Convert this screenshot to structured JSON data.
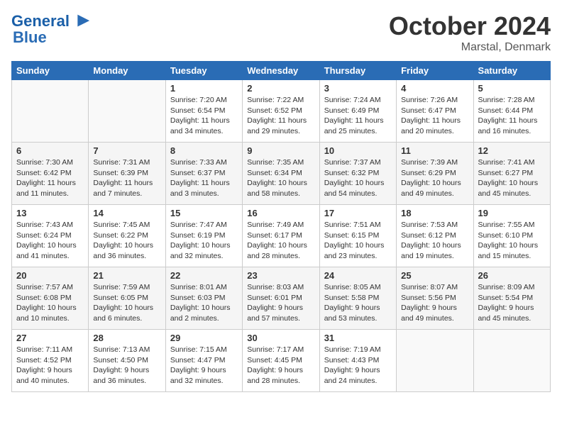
{
  "header": {
    "logo_line1": "General",
    "logo_line2": "Blue",
    "month": "October 2024",
    "location": "Marstal, Denmark"
  },
  "weekdays": [
    "Sunday",
    "Monday",
    "Tuesday",
    "Wednesday",
    "Thursday",
    "Friday",
    "Saturday"
  ],
  "weeks": [
    [
      {
        "day": "",
        "sunrise": "",
        "sunset": "",
        "daylight": ""
      },
      {
        "day": "",
        "sunrise": "",
        "sunset": "",
        "daylight": ""
      },
      {
        "day": "1",
        "sunrise": "Sunrise: 7:20 AM",
        "sunset": "Sunset: 6:54 PM",
        "daylight": "Daylight: 11 hours and 34 minutes."
      },
      {
        "day": "2",
        "sunrise": "Sunrise: 7:22 AM",
        "sunset": "Sunset: 6:52 PM",
        "daylight": "Daylight: 11 hours and 29 minutes."
      },
      {
        "day": "3",
        "sunrise": "Sunrise: 7:24 AM",
        "sunset": "Sunset: 6:49 PM",
        "daylight": "Daylight: 11 hours and 25 minutes."
      },
      {
        "day": "4",
        "sunrise": "Sunrise: 7:26 AM",
        "sunset": "Sunset: 6:47 PM",
        "daylight": "Daylight: 11 hours and 20 minutes."
      },
      {
        "day": "5",
        "sunrise": "Sunrise: 7:28 AM",
        "sunset": "Sunset: 6:44 PM",
        "daylight": "Daylight: 11 hours and 16 minutes."
      }
    ],
    [
      {
        "day": "6",
        "sunrise": "Sunrise: 7:30 AM",
        "sunset": "Sunset: 6:42 PM",
        "daylight": "Daylight: 11 hours and 11 minutes."
      },
      {
        "day": "7",
        "sunrise": "Sunrise: 7:31 AM",
        "sunset": "Sunset: 6:39 PM",
        "daylight": "Daylight: 11 hours and 7 minutes."
      },
      {
        "day": "8",
        "sunrise": "Sunrise: 7:33 AM",
        "sunset": "Sunset: 6:37 PM",
        "daylight": "Daylight: 11 hours and 3 minutes."
      },
      {
        "day": "9",
        "sunrise": "Sunrise: 7:35 AM",
        "sunset": "Sunset: 6:34 PM",
        "daylight": "Daylight: 10 hours and 58 minutes."
      },
      {
        "day": "10",
        "sunrise": "Sunrise: 7:37 AM",
        "sunset": "Sunset: 6:32 PM",
        "daylight": "Daylight: 10 hours and 54 minutes."
      },
      {
        "day": "11",
        "sunrise": "Sunrise: 7:39 AM",
        "sunset": "Sunset: 6:29 PM",
        "daylight": "Daylight: 10 hours and 49 minutes."
      },
      {
        "day": "12",
        "sunrise": "Sunrise: 7:41 AM",
        "sunset": "Sunset: 6:27 PM",
        "daylight": "Daylight: 10 hours and 45 minutes."
      }
    ],
    [
      {
        "day": "13",
        "sunrise": "Sunrise: 7:43 AM",
        "sunset": "Sunset: 6:24 PM",
        "daylight": "Daylight: 10 hours and 41 minutes."
      },
      {
        "day": "14",
        "sunrise": "Sunrise: 7:45 AM",
        "sunset": "Sunset: 6:22 PM",
        "daylight": "Daylight: 10 hours and 36 minutes."
      },
      {
        "day": "15",
        "sunrise": "Sunrise: 7:47 AM",
        "sunset": "Sunset: 6:19 PM",
        "daylight": "Daylight: 10 hours and 32 minutes."
      },
      {
        "day": "16",
        "sunrise": "Sunrise: 7:49 AM",
        "sunset": "Sunset: 6:17 PM",
        "daylight": "Daylight: 10 hours and 28 minutes."
      },
      {
        "day": "17",
        "sunrise": "Sunrise: 7:51 AM",
        "sunset": "Sunset: 6:15 PM",
        "daylight": "Daylight: 10 hours and 23 minutes."
      },
      {
        "day": "18",
        "sunrise": "Sunrise: 7:53 AM",
        "sunset": "Sunset: 6:12 PM",
        "daylight": "Daylight: 10 hours and 19 minutes."
      },
      {
        "day": "19",
        "sunrise": "Sunrise: 7:55 AM",
        "sunset": "Sunset: 6:10 PM",
        "daylight": "Daylight: 10 hours and 15 minutes."
      }
    ],
    [
      {
        "day": "20",
        "sunrise": "Sunrise: 7:57 AM",
        "sunset": "Sunset: 6:08 PM",
        "daylight": "Daylight: 10 hours and 10 minutes."
      },
      {
        "day": "21",
        "sunrise": "Sunrise: 7:59 AM",
        "sunset": "Sunset: 6:05 PM",
        "daylight": "Daylight: 10 hours and 6 minutes."
      },
      {
        "day": "22",
        "sunrise": "Sunrise: 8:01 AM",
        "sunset": "Sunset: 6:03 PM",
        "daylight": "Daylight: 10 hours and 2 minutes."
      },
      {
        "day": "23",
        "sunrise": "Sunrise: 8:03 AM",
        "sunset": "Sunset: 6:01 PM",
        "daylight": "Daylight: 9 hours and 57 minutes."
      },
      {
        "day": "24",
        "sunrise": "Sunrise: 8:05 AM",
        "sunset": "Sunset: 5:58 PM",
        "daylight": "Daylight: 9 hours and 53 minutes."
      },
      {
        "day": "25",
        "sunrise": "Sunrise: 8:07 AM",
        "sunset": "Sunset: 5:56 PM",
        "daylight": "Daylight: 9 hours and 49 minutes."
      },
      {
        "day": "26",
        "sunrise": "Sunrise: 8:09 AM",
        "sunset": "Sunset: 5:54 PM",
        "daylight": "Daylight: 9 hours and 45 minutes."
      }
    ],
    [
      {
        "day": "27",
        "sunrise": "Sunrise: 7:11 AM",
        "sunset": "Sunset: 4:52 PM",
        "daylight": "Daylight: 9 hours and 40 minutes."
      },
      {
        "day": "28",
        "sunrise": "Sunrise: 7:13 AM",
        "sunset": "Sunset: 4:50 PM",
        "daylight": "Daylight: 9 hours and 36 minutes."
      },
      {
        "day": "29",
        "sunrise": "Sunrise: 7:15 AM",
        "sunset": "Sunset: 4:47 PM",
        "daylight": "Daylight: 9 hours and 32 minutes."
      },
      {
        "day": "30",
        "sunrise": "Sunrise: 7:17 AM",
        "sunset": "Sunset: 4:45 PM",
        "daylight": "Daylight: 9 hours and 28 minutes."
      },
      {
        "day": "31",
        "sunrise": "Sunrise: 7:19 AM",
        "sunset": "Sunset: 4:43 PM",
        "daylight": "Daylight: 9 hours and 24 minutes."
      },
      {
        "day": "",
        "sunrise": "",
        "sunset": "",
        "daylight": ""
      },
      {
        "day": "",
        "sunrise": "",
        "sunset": "",
        "daylight": ""
      }
    ]
  ]
}
